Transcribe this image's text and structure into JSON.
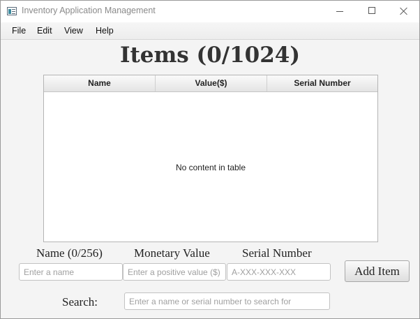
{
  "window": {
    "title": "Inventory Application Management",
    "icon": "app-window-icon",
    "controls": [
      "minimize-icon",
      "maximize-icon",
      "close-icon"
    ]
  },
  "menu": {
    "items": [
      "File",
      "Edit",
      "View",
      "Help"
    ]
  },
  "page": {
    "title": "Items (0/1024)"
  },
  "table": {
    "columns": [
      "Name",
      "Value($)",
      "Serial Number"
    ],
    "rows": [],
    "empty_message": "No content in table"
  },
  "form": {
    "name_label": "Name (0/256)",
    "value_label": "Monetary Value",
    "serial_label": "Serial Number",
    "name_input": {
      "value": "",
      "placeholder": "Enter a name"
    },
    "value_input": {
      "value": "",
      "placeholder": "Enter a positive value ($)"
    },
    "serial_input": {
      "value": "",
      "placeholder": "A-XXX-XXX-XXX"
    },
    "add_button_label": "Add Item"
  },
  "search": {
    "label": "Search:",
    "input": {
      "value": "",
      "placeholder": "Enter a name or serial number to search for"
    }
  }
}
